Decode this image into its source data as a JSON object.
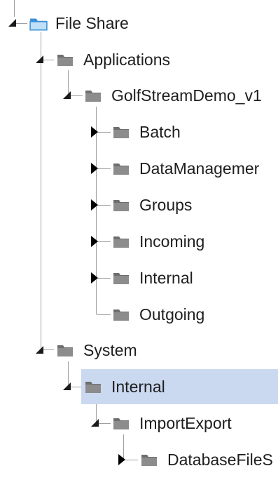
{
  "tree": {
    "root": {
      "label": "File Share",
      "icon": "share-folder-icon",
      "expanded": true
    },
    "applications": {
      "label": "Applications",
      "expanded": true,
      "golfstream": {
        "label": "GolfStreamDemo_v1",
        "expanded": true,
        "children": [
          {
            "label": "Batch",
            "expanded": false
          },
          {
            "label": "DataManagemer",
            "expanded": false
          },
          {
            "label": "Groups",
            "expanded": false
          },
          {
            "label": "Incoming",
            "expanded": false
          },
          {
            "label": "Internal",
            "expanded": false
          },
          {
            "label": "Outgoing",
            "has_children": false
          }
        ]
      }
    },
    "system": {
      "label": "System",
      "expanded": true,
      "internal": {
        "label": "Internal",
        "selected": true,
        "expanded": true,
        "importexport": {
          "label": "ImportExport",
          "expanded": true,
          "databasefile": {
            "label": "DatabaseFileS",
            "expanded": false
          }
        }
      }
    }
  },
  "colors": {
    "selection": "#cbd9f0",
    "connector_line": "#a0a0a0",
    "folder_icon": "#6e6e6e",
    "share_folder_icon": "#3a8fd6"
  }
}
